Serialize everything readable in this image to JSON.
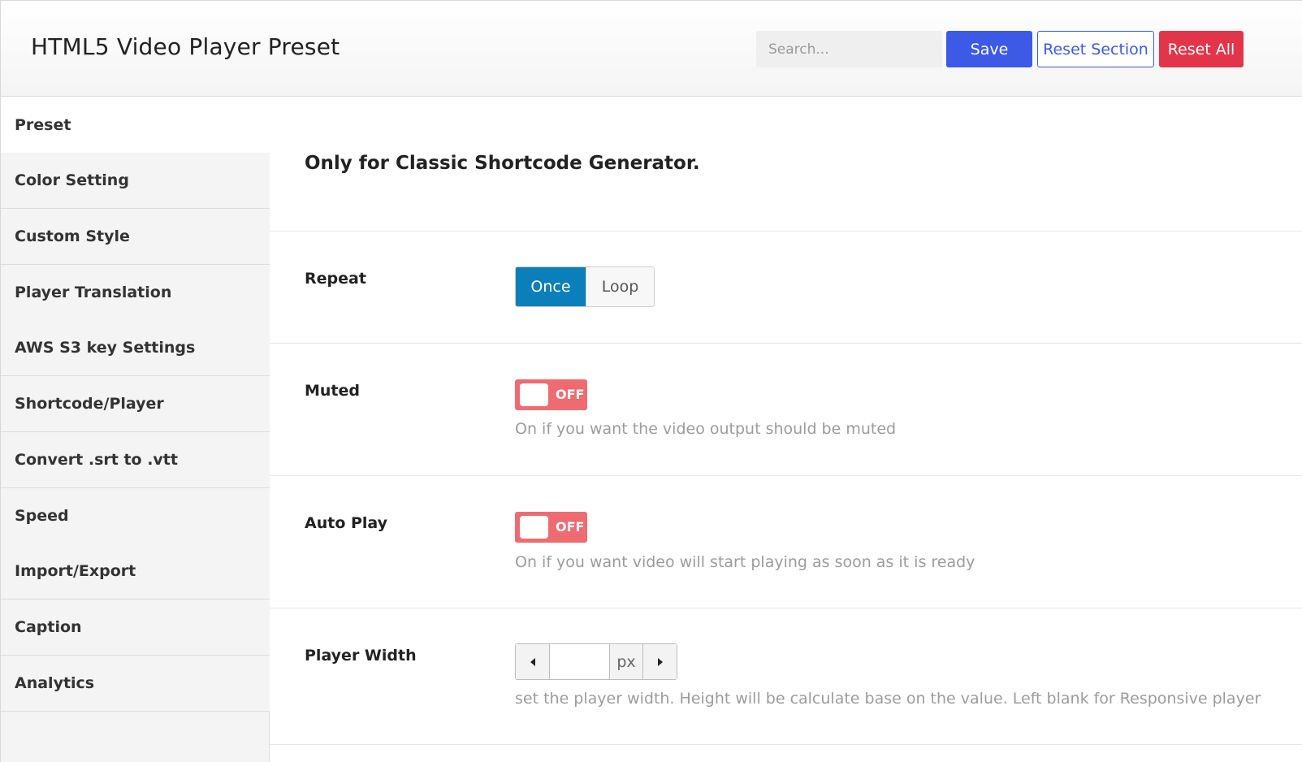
{
  "header": {
    "title": "HTML5 Video Player Preset",
    "search_placeholder": "Search...",
    "save_label": "Save",
    "reset_section_label": "Reset Section",
    "reset_all_label": "Reset All"
  },
  "sidebar": {
    "items": [
      {
        "label": "Preset",
        "active": true
      },
      {
        "label": "Color Setting"
      },
      {
        "label": "Custom Style"
      },
      {
        "label": "Player Translation"
      },
      {
        "label": "AWS S3 key Settings"
      },
      {
        "label": "Shortcode/Player"
      },
      {
        "label": "Convert .srt to .vtt"
      },
      {
        "label": "Speed"
      },
      {
        "label": "Import/Export"
      },
      {
        "label": "Caption"
      },
      {
        "label": "Analytics"
      }
    ]
  },
  "main": {
    "section_title": "Only for Classic Shortcode Generator.",
    "repeat": {
      "label": "Repeat",
      "options": [
        "Once",
        "Loop"
      ],
      "selected": "Once"
    },
    "muted": {
      "label": "Muted",
      "state": "OFF",
      "help": "On if you want the video output should be muted"
    },
    "autoplay": {
      "label": "Auto Play",
      "state": "OFF",
      "help": "On if you want video will start playing as soon as it is ready"
    },
    "player_width": {
      "label": "Player Width",
      "value": "",
      "unit": "px",
      "help": "set the player width. Height will be calculate base on the value. Left blank for Responsive player"
    }
  },
  "colors": {
    "primary": "#3c5ae6",
    "danger": "#e3354a",
    "segment_active": "#0b7fba",
    "toggle_off": "#ee6b72"
  }
}
